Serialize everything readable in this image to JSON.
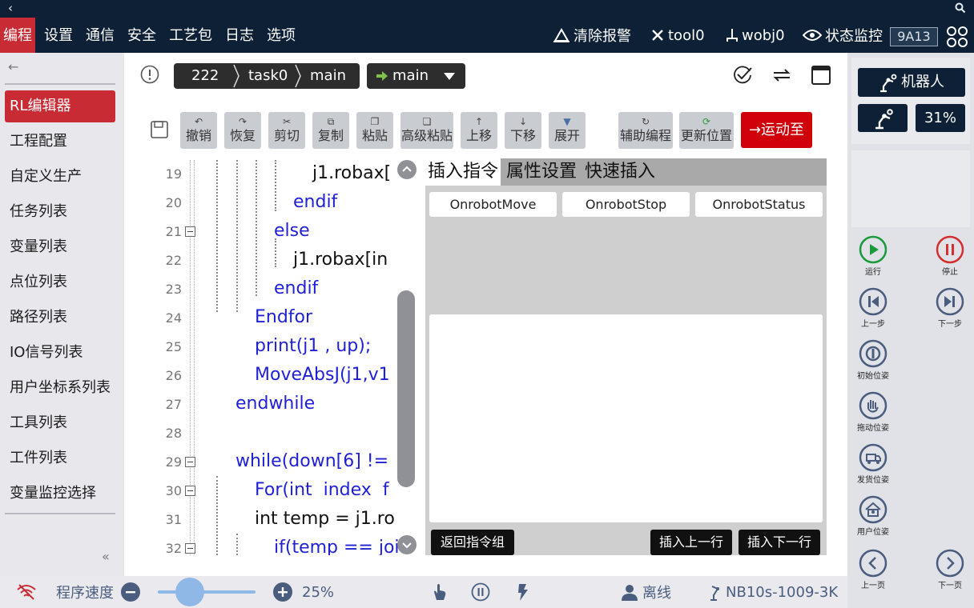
{
  "titlebar": {
    "back_icon": "chevron-left-icon",
    "search_icon": "search-icon"
  },
  "menu": {
    "items": [
      "编程",
      "设置",
      "通信",
      "安全",
      "工艺包",
      "日志",
      "选项"
    ],
    "active": "编程",
    "clear_alarm": "清除报警",
    "tool": "tool0",
    "wobj": "wobj0",
    "status_monitor": "状态监控",
    "code_badge": "9A13"
  },
  "sidebar": {
    "items": [
      "RL编辑器",
      "工程配置",
      "自定义生产",
      "任务列表",
      "变量列表",
      "点位列表",
      "路径列表",
      "IO信号列表",
      "用户坐标系列表",
      "工具列表",
      "工件列表",
      "变量监控选择"
    ],
    "active": "RL编辑器",
    "collapse_label": "«"
  },
  "editor": {
    "breadcrumb": [
      "222",
      "task0",
      "main"
    ],
    "task_select": "main",
    "toolbar": [
      {
        "name": "undo",
        "label": "撤销",
        "icon": "↶"
      },
      {
        "name": "redo",
        "label": "恢复",
        "icon": "↷"
      },
      {
        "name": "cut",
        "label": "剪切",
        "icon": "✂"
      },
      {
        "name": "copy",
        "label": "复制",
        "icon": "⧉"
      },
      {
        "name": "paste",
        "label": "粘贴",
        "icon": "❐"
      },
      {
        "name": "advanced-paste",
        "label": "高级粘贴",
        "icon": "❏"
      },
      {
        "name": "move-up",
        "label": "上移",
        "icon": "↑"
      },
      {
        "name": "move-down",
        "label": "下移",
        "icon": "↓"
      },
      {
        "name": "expand",
        "label": "展开",
        "icon": "▼"
      },
      {
        "name": "assist-programming",
        "label": "辅助编程",
        "icon": "↻"
      },
      {
        "name": "update-position",
        "label": "更新位置",
        "icon": "⟳"
      }
    ],
    "run_to": "→运动至",
    "code_lines": [
      {
        "n": "19",
        "text": "j1.robax["
      },
      {
        "n": "20",
        "text": "endif"
      },
      {
        "n": "21",
        "text": "else"
      },
      {
        "n": "22",
        "text": "j1.robax[in"
      },
      {
        "n": "23",
        "text": "endif"
      },
      {
        "n": "24",
        "text": "Endfor"
      },
      {
        "n": "25",
        "text": "print(j1 , up);"
      },
      {
        "n": "26",
        "text": "MoveAbsJ(j1,v1"
      },
      {
        "n": "27",
        "text": "endwhile"
      },
      {
        "n": "28",
        "text": ""
      },
      {
        "n": "29",
        "text": "while(down[6] !="
      },
      {
        "n": "30",
        "text": "For(int  index  f"
      },
      {
        "n": "31",
        "text": "int temp = j1.ro"
      },
      {
        "n": "32",
        "text": "if(temp == joi"
      }
    ]
  },
  "panel": {
    "tabs": [
      "插入指令",
      "属性设置",
      "快速插入"
    ],
    "active_tab": "插入指令",
    "commands": [
      "OnrobotMove",
      "OnrobotStop",
      "OnrobotStatus"
    ],
    "back_group": "返回指令组",
    "insert_above": "插入上一行",
    "insert_below": "插入下一行"
  },
  "right_panel": {
    "robot": "机器人",
    "percent": "31%",
    "controls": [
      {
        "label": "运行",
        "icon": "play-icon",
        "color": "#1a9b3a"
      },
      {
        "label": "停止",
        "icon": "pause-icon",
        "color": "#d32f2f"
      },
      {
        "label": "上一步",
        "icon": "step-back-icon",
        "color": "#4a5d7e"
      },
      {
        "label": "下一步",
        "icon": "step-forward-icon",
        "color": "#4a5d7e"
      },
      {
        "label": "初始位姿",
        "icon": "home-pose-icon",
        "color": "#4a5d7e"
      },
      {
        "label": "拖动位姿",
        "icon": "drag-pose-icon",
        "color": "#4a5d7e"
      },
      {
        "label": "发货位姿",
        "icon": "ship-pose-icon",
        "color": "#4a5d7e"
      },
      {
        "label": "用户位姿",
        "icon": "user-pose-icon",
        "color": "#4a5d7e"
      },
      {
        "label": "上一页",
        "icon": "prev-page-icon",
        "color": "#4a5d7e"
      },
      {
        "label": "下一页",
        "icon": "next-page-icon",
        "color": "#4a5d7e"
      }
    ]
  },
  "bottombar": {
    "speed_label": "程序速度",
    "speed_value": "25%",
    "speed_fraction": 0.25,
    "status": "离线",
    "device": "NB10s-1009-3K"
  }
}
